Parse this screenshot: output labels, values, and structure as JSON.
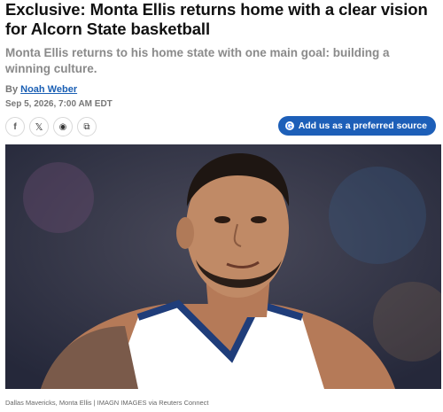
{
  "article": {
    "headline": "Exclusive: Monta Ellis returns home with a clear vision for Alcorn State basketball",
    "subheadline": "Monta Ellis returns to his home state with one main goal: building a winning culture.",
    "byline_prefix": "By",
    "author": "Noah Weber",
    "date": "Sep 5, 2026, 7:00 AM EDT"
  },
  "share": {
    "facebook_glyph": "f",
    "x_glyph": "𝕏",
    "reddit_glyph": "◉",
    "copy_glyph": "⧉"
  },
  "preferred_source": {
    "label": "Add us as a preferred source",
    "icon_letter": "G"
  },
  "photo": {
    "caption": "Dallas Mavericks, Monta Ellis | IMAGN IMAGES via Reuters Connect",
    "jersey_color": "#ffffff",
    "jersey_trim": "#1f3d7a"
  }
}
